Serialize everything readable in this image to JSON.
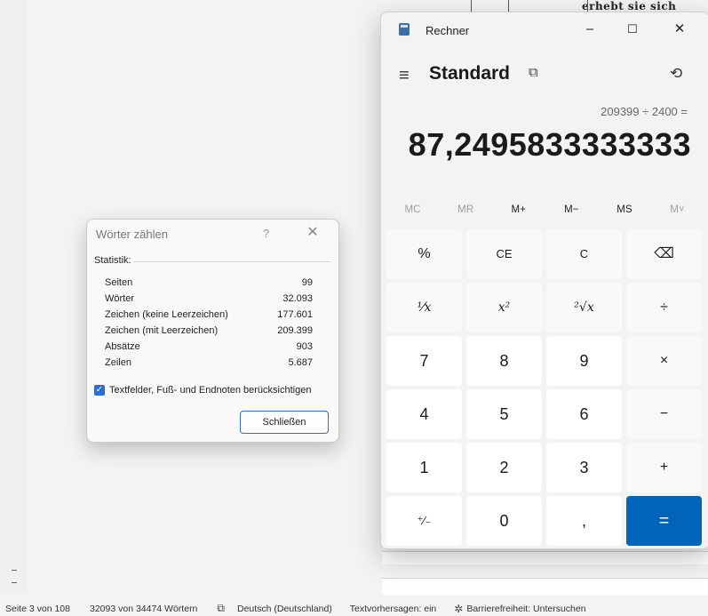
{
  "document": {
    "snippet": "erhebt sie sich"
  },
  "status_bar": {
    "page": "Seite 3 von 108",
    "words": "32093 von 34474 Wörtern",
    "language": "Deutsch (Deutschland)",
    "predictions": "Textvorhersagen: ein",
    "accessibility": "Barrierefreiheit: Untersuchen"
  },
  "word_count_dialog": {
    "title": "Wörter zählen",
    "help": "?",
    "close": "✕",
    "group_label": "Statistik:",
    "stats": [
      {
        "label": "Seiten",
        "value": "99"
      },
      {
        "label": "Wörter",
        "value": "32.093"
      },
      {
        "label": "Zeichen (keine Leerzeichen)",
        "value": "177.601"
      },
      {
        "label": "Zeichen (mit Leerzeichen)",
        "value": "209.399"
      },
      {
        "label": "Absätze",
        "value": "903"
      },
      {
        "label": "Zeilen",
        "value": "5.687"
      }
    ],
    "checkbox_label": "Textfelder, Fuß- und Endnoten berücksichtigen",
    "checkbox_checked": true,
    "close_button": "Schließen",
    "accent": "#2b6cd6"
  },
  "calculator": {
    "app_title": "Rechner",
    "minimize": "–",
    "maximize": "☐",
    "close": "✕",
    "menu_icon": "≡",
    "mode": "Standard",
    "keep_on_top_icon": "⧉",
    "history_icon": "⟲",
    "expression": "209399 ÷ 2400 =",
    "result": "87,2495833333333",
    "memory": [
      {
        "label": "MC",
        "disabled": true
      },
      {
        "label": "MR",
        "disabled": true
      },
      {
        "label": "M+",
        "disabled": false
      },
      {
        "label": "M−",
        "disabled": false
      },
      {
        "label": "MS",
        "disabled": false
      },
      {
        "label": "M˅",
        "disabled": true
      }
    ],
    "keys": {
      "percent": "%",
      "ce": "CE",
      "c": "C",
      "backspace": "⌫",
      "reciprocal": "¹⁄x",
      "square": "x²",
      "sqrt": "²√x",
      "divide": "÷",
      "seven": "7",
      "eight": "8",
      "nine": "9",
      "multiply": "×",
      "four": "4",
      "five": "5",
      "six": "6",
      "minus": "−",
      "one": "1",
      "two": "2",
      "three": "3",
      "plus": "+",
      "negate": "⁺⁄₋",
      "zero": "0",
      "decimal": ",",
      "equals": "="
    },
    "accent": "#0065b8"
  }
}
